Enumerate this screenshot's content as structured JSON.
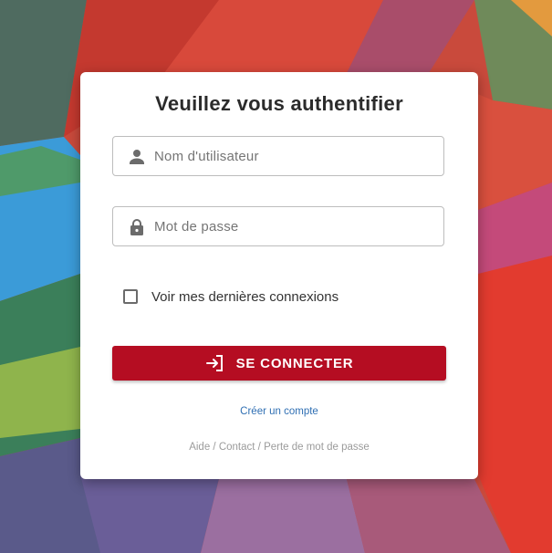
{
  "login": {
    "title": "Veuillez vous authentifier",
    "username_placeholder": "Nom d'utilisateur",
    "password_placeholder": "Mot de passe",
    "remember_label": "Voir mes dernières connexions",
    "remember_checked": false,
    "submit_label": "SE CONNECTER",
    "create_account_label": "Créer un compte",
    "footer": {
      "help": "Aide",
      "contact": "Contact",
      "lost_password": "Perte de mot de passe",
      "separator": " / "
    }
  },
  "icons": {
    "username": "person-icon",
    "password": "lock-icon",
    "submit": "login-icon"
  },
  "colors": {
    "primary_button": "#b50d22",
    "link": "#2f6fb3",
    "card_background": "#ffffff"
  }
}
